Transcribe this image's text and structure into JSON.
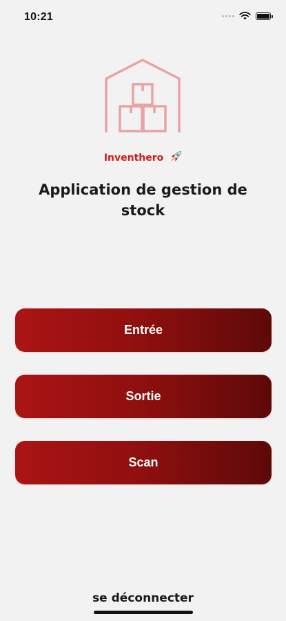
{
  "status_bar": {
    "time": "10:21"
  },
  "brand": {
    "name": "Inventhero",
    "logo_icon": "warehouse-boxes-icon",
    "emoji_icon": "rocket-icon",
    "accent_color": "#d01b1b"
  },
  "title": "Application de gestion de stock",
  "buttons": {
    "entree": "Entrée",
    "sortie": "Sortie",
    "scan": "Scan",
    "gradient_start": "#ab1414",
    "gradient_end": "#5e0909"
  },
  "footer": {
    "logout_label": "se déconnecter"
  }
}
